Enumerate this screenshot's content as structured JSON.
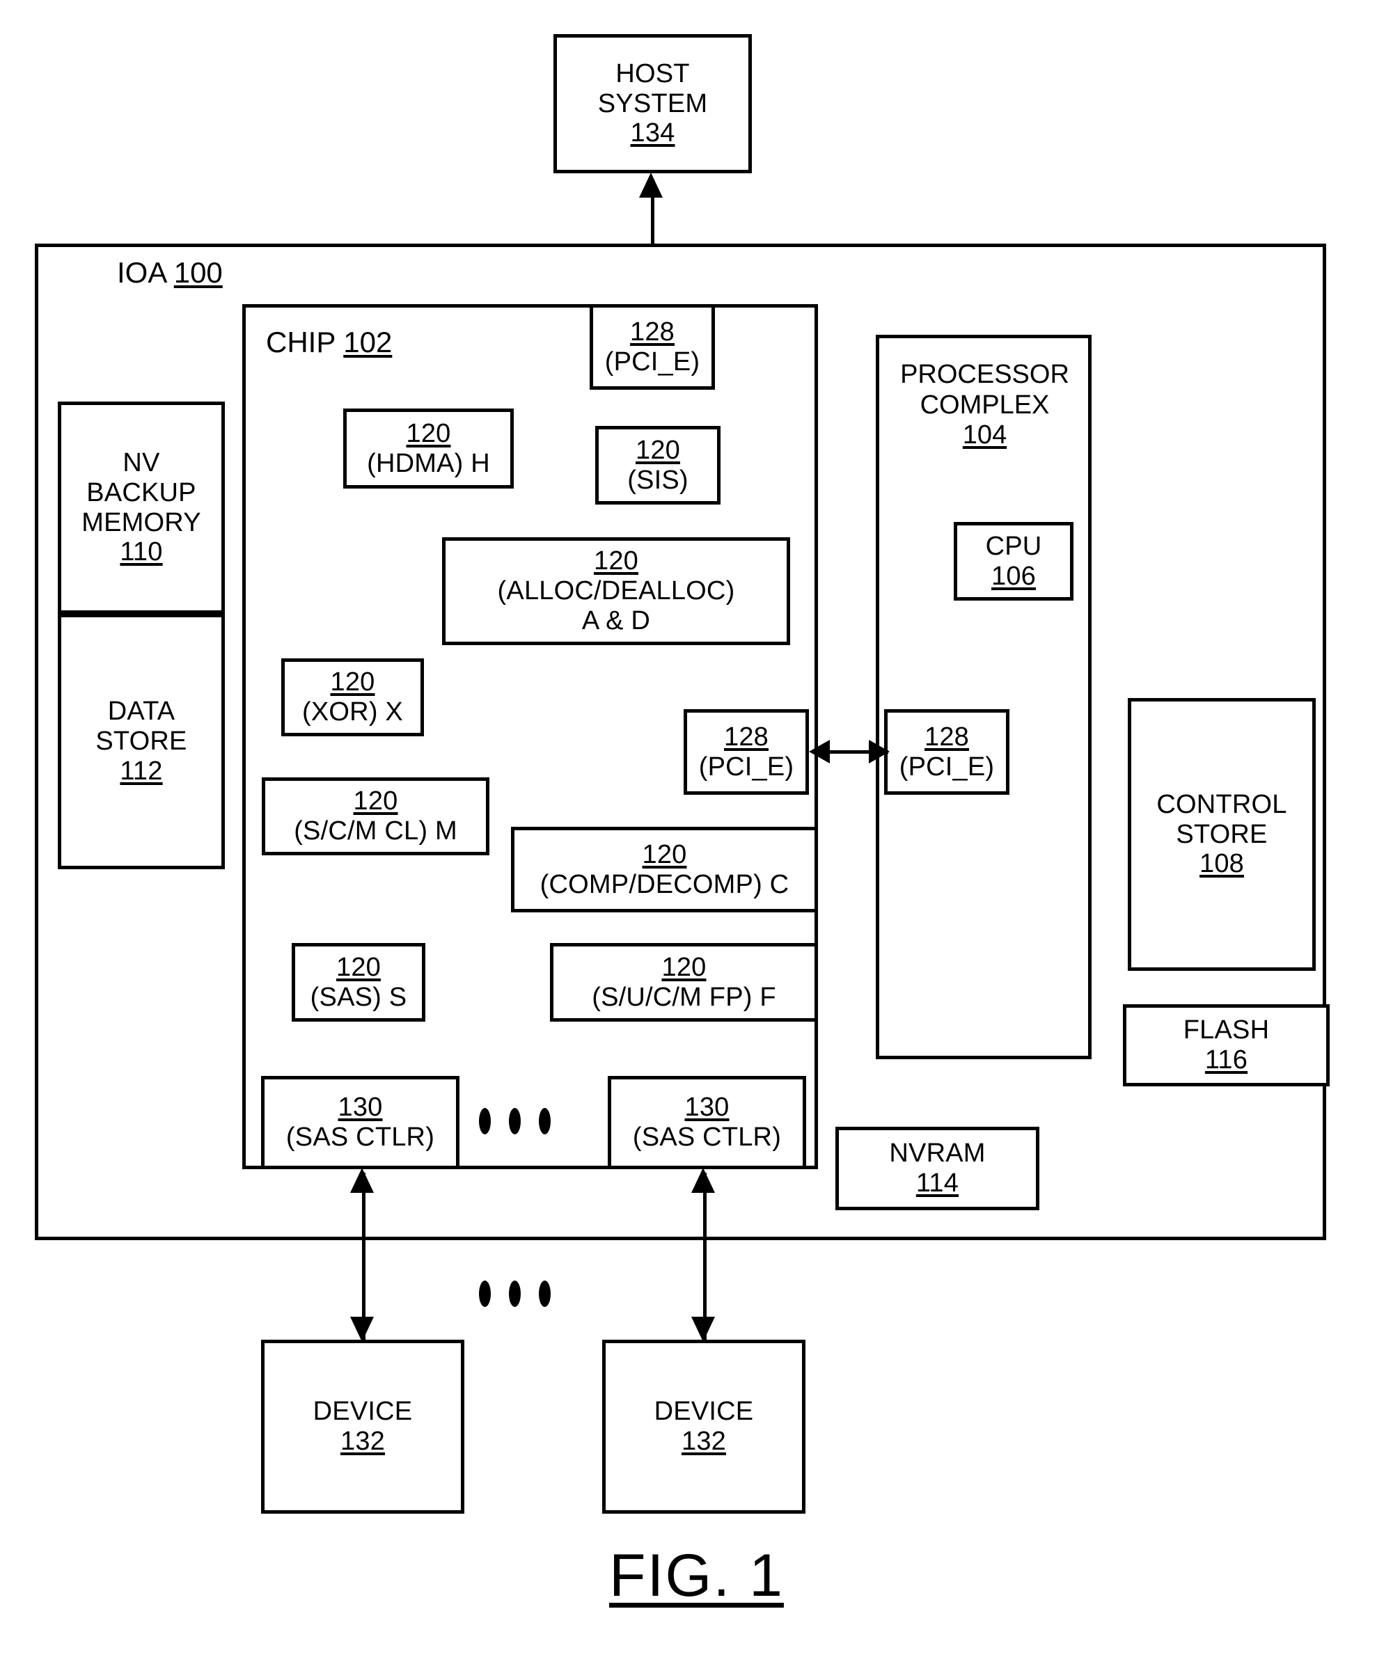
{
  "figure": {
    "caption": "FIG. 1"
  },
  "host": {
    "title_line1": "HOST",
    "title_line2": "SYSTEM",
    "ref": "134"
  },
  "ioa": {
    "label_text": "IOA",
    "label_ref": "100"
  },
  "chip": {
    "label_text": "CHIP",
    "label_ref": "102"
  },
  "memory": {
    "nv_backup": {
      "line1": "NV",
      "line2": "BACKUP",
      "line3": "MEMORY",
      "ref": "110"
    },
    "data_store": {
      "line1": "DATA",
      "line2": "STORE",
      "ref": "112"
    }
  },
  "chip_blocks": [
    {
      "ref": "128",
      "name": "(PCI_E)"
    },
    {
      "ref": "120",
      "name": "(HDMA) H"
    },
    {
      "ref": "120",
      "name": "(SIS)"
    },
    {
      "ref": "120",
      "name": "(ALLOC/DEALLOC)",
      "name2": "A & D"
    },
    {
      "ref": "120",
      "name": "(XOR) X"
    },
    {
      "ref": "120",
      "name": "(S/C/M CL) M"
    },
    {
      "ref": "120",
      "name": "(COMP/DECOMP) C"
    },
    {
      "ref": "120",
      "name": "(SAS) S"
    },
    {
      "ref": "120",
      "name": "(S/U/C/M FP) F"
    },
    {
      "ref": "128",
      "name": "(PCI_E)"
    },
    {
      "ref": "130",
      "name": "(SAS CTLR)"
    },
    {
      "ref": "130",
      "name": "(SAS CTLR)"
    }
  ],
  "processor_complex": {
    "line1": "PROCESSOR",
    "line2": "COMPLEX",
    "ref": "104",
    "cpu": {
      "name": "CPU",
      "ref": "106"
    },
    "pcie": {
      "ref": "128",
      "name": "(PCI_E)"
    }
  },
  "control_store": {
    "line1": "CONTROL",
    "line2": "STORE",
    "ref": "108"
  },
  "flash": {
    "name": "FLASH",
    "ref": "116"
  },
  "nvram": {
    "name": "NVRAM",
    "ref": "114"
  },
  "devices": [
    {
      "name": "DEVICE",
      "ref": "132"
    },
    {
      "name": "DEVICE",
      "ref": "132"
    }
  ],
  "colors": {
    "stroke": "#000000",
    "background": "#ffffff"
  }
}
